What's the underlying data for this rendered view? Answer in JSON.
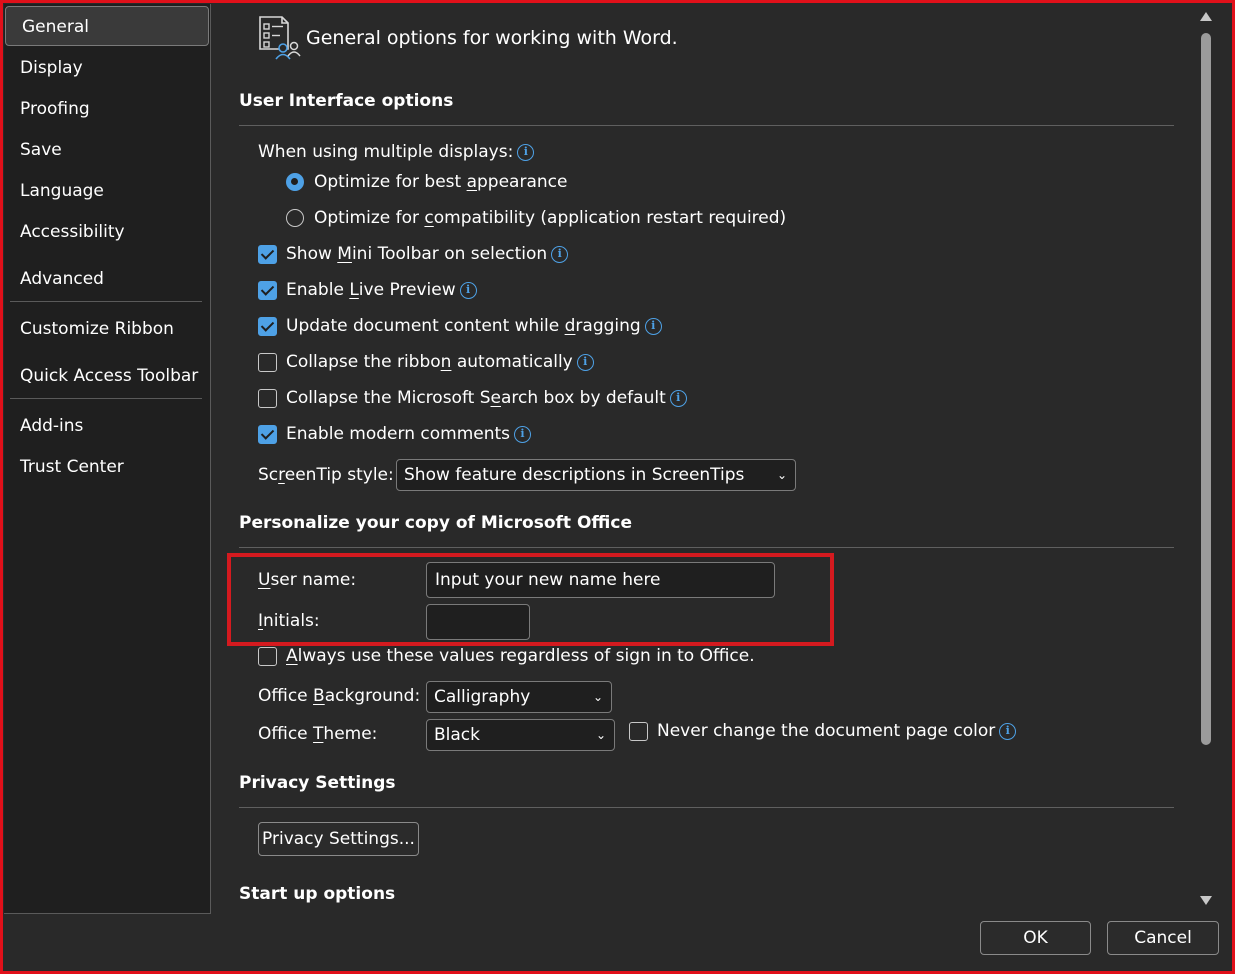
{
  "sidebar": {
    "items": [
      {
        "label": "General",
        "selected": true
      },
      {
        "label": "Display"
      },
      {
        "label": "Proofing"
      },
      {
        "label": "Save"
      },
      {
        "label": "Language"
      },
      {
        "label": "Accessibility"
      },
      {
        "label": "Advanced"
      },
      {
        "label": "Customize Ribbon"
      },
      {
        "label": "Quick Access Toolbar"
      },
      {
        "label": "Add-ins"
      },
      {
        "label": "Trust Center"
      }
    ]
  },
  "header": {
    "icon": "general-options-icon",
    "text": "General options for working with Word."
  },
  "ui_options": {
    "title": "User Interface options",
    "multiple_displays_label": "When using multiple displays:",
    "radio_best": {
      "pre": "Optimize for best ",
      "u": "a",
      "post": "ppearance",
      "selected": true
    },
    "radio_compat": {
      "pre": "Optimize for ",
      "u": "c",
      "post": "ompatibility (application restart required)",
      "selected": false
    },
    "checks": [
      {
        "pre": "Show ",
        "u": "M",
        "post": "ini Toolbar on selection",
        "checked": true
      },
      {
        "pre": "Enable ",
        "u": "L",
        "post": "ive Preview",
        "checked": true
      },
      {
        "pre": "Update document content while ",
        "u": "d",
        "post": "ragging",
        "checked": true
      },
      {
        "pre": "Collapse the ribbo",
        "u": "n",
        "post": " automatically",
        "checked": false
      },
      {
        "pre": "Collapse the Microsoft S",
        "u": "e",
        "post": "arch box by default",
        "checked": false
      },
      {
        "pre": "Enable modern comments",
        "u": "",
        "post": "",
        "checked": true
      }
    ],
    "screentip_label": {
      "pre": "Sc",
      "u": "r",
      "post": "eenTip style:"
    },
    "screentip_value": "Show feature descriptions in ScreenTips"
  },
  "personalize": {
    "title": "Personalize your copy of Microsoft Office",
    "username_label": {
      "u": "U",
      "post": "ser name:"
    },
    "username_value": "Input your new name here",
    "initials_label": {
      "u": "I",
      "post": "nitials:"
    },
    "initials_value": "",
    "always_use": {
      "u": "A",
      "post": "lways use these values regardless of sign in to Office.",
      "checked": false
    },
    "background_label": {
      "pre": "Office ",
      "u": "B",
      "post": "ackground:"
    },
    "background_value": "Calligraphy",
    "theme_label": {
      "pre": "Office ",
      "u": "T",
      "post": "heme:"
    },
    "theme_value": "Black",
    "never_change": {
      "label": "Never change the document page color",
      "checked": false
    }
  },
  "privacy": {
    "title": "Privacy Settings",
    "button": "Privacy Settings..."
  },
  "startup": {
    "title": "Start up options"
  },
  "footer": {
    "ok": "OK",
    "cancel": "Cancel"
  },
  "colors": {
    "accent": "#4ea1e6",
    "highlight_box": "#d41a1f",
    "background": "#292929",
    "sidebar": "#1f1f1f"
  },
  "info_icon_glyph": "i"
}
